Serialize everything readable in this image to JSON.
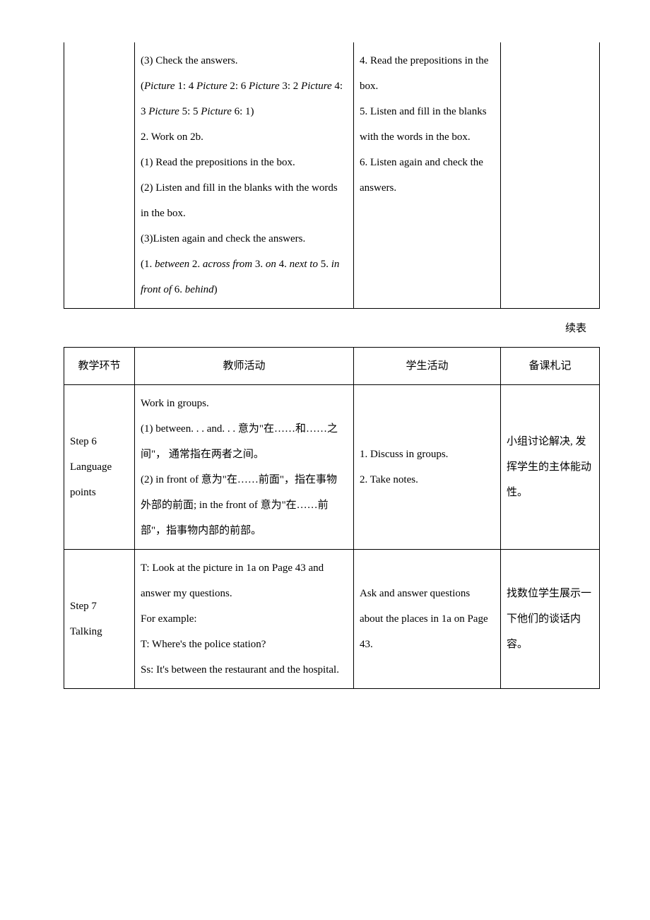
{
  "table1": {
    "row1_col2_line1": "(3) Check the answers.",
    "row1_col2_pic1": "Picture",
    "row1_col2_pic1_val": " 1: 4 ",
    "row1_col2_pic2": "Picture",
    "row1_col2_pic2_val": " 2: 6 ",
    "row1_col2_pic3": "Picture",
    "row1_col2_pic3_val": " 3: 2 ",
    "row1_col2_pic4": "Picture",
    "row1_col2_pic4_val": " 4: 3 ",
    "row1_col2_pic5": "Picture",
    "row1_col2_pic5_val": " 5: 5 ",
    "row1_col2_pic6": "Picture",
    "row1_col2_pic6_val": " 6: 1)",
    "row1_col2_line2": "2. Work on 2b.",
    "row1_col2_line3": "(1) Read the prepositions in the box.",
    "row1_col2_line4": "(2) Listen and fill in the blanks with the words in the box.",
    "row1_col2_line5": "(3)Listen again and check the answers.",
    "row1_col2_ans_open": "(1. ",
    "row1_col2_ans1": "between",
    "row1_col2_sep2": " 2. ",
    "row1_col2_ans2": "across from",
    "row1_col2_sep3": " 3. ",
    "row1_col2_ans3": "on",
    "row1_col2_sep4": " 4. ",
    "row1_col2_ans4": "next to",
    "row1_col2_sep5": " 5. ",
    "row1_col2_ans5": "in front of",
    "row1_col2_sep6": " 6. ",
    "row1_col2_ans6": "behind",
    "row1_col2_ans_close": ")",
    "row1_col3_line1": "4. Read the prepositions in the box.",
    "row1_col3_line2": "5. Listen and fill in the blanks with the words in the box.",
    "row1_col3_line3": "6. Listen again and check the answers."
  },
  "continued_label": "续表",
  "table2": {
    "header": {
      "col1": "教学环节",
      "col2": "教师活动",
      "col3": "学生活动",
      "col4": "备课札记"
    },
    "row1": {
      "col1": "Step 6 Language points",
      "col2_line1": "Work in groups.",
      "col2_line2": "(1) between. . . and. . .  意为\"在……和……之间\"， 通常指在两者之间。",
      "col2_line3": "(2) in front of 意为\"在……前面\"，指在事物外部的前面; in the front of 意为\"在……前部\"，指事物内部的前部。",
      "col3_line1": "1. Discuss in groups.",
      "col3_line2": "2. Take notes.",
      "col4": "小组讨论解决, 发挥学生的主体能动性。"
    },
    "row2": {
      "col1": "Step 7  Talking",
      "col2_line1": "T: Look at the picture in 1a on Page 43 and answer my questions.",
      "col2_line2": "For example:",
      "col2_line3": "T: Where's the police station?",
      "col2_line4": "Ss: It's between the restaurant and the hospital.",
      "col3": "Ask and answer questions about the places in 1a on Page 43.",
      "col4": "找数位学生展示一下他们的谈话内容。"
    }
  }
}
